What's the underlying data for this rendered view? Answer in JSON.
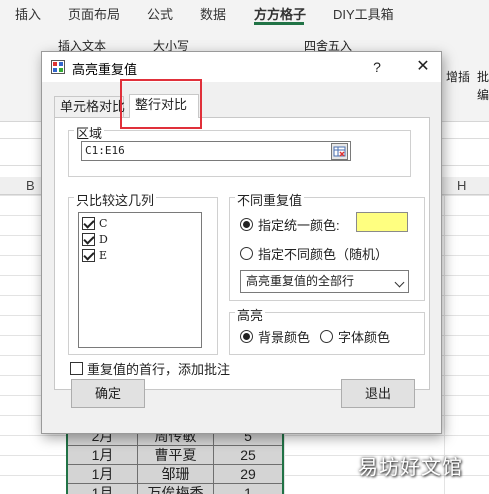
{
  "excel": {
    "tabs": [
      "插入",
      "页面布局",
      "公式",
      "数据",
      "方方格子",
      "DIY工具箱"
    ],
    "active_tab": "方方格子",
    "ribbon": {
      "insert_text": "插入文本",
      "case": "大小写",
      "round": "四舍五入",
      "insert": "增插",
      "batch": "批",
      "edit": "编"
    },
    "column_headers": [
      "B",
      "H"
    ],
    "rows": [
      [
        "2月",
        "周传敏",
        "5"
      ],
      [
        "1月",
        "曹平夏",
        "25"
      ],
      [
        "1月",
        "邹珊",
        "29"
      ],
      [
        "1月",
        "万俟梅香",
        "1"
      ]
    ]
  },
  "dialog": {
    "title": "高亮重复值",
    "help": "?",
    "close": "✕",
    "tabs": [
      "单元格对比",
      "整行对比"
    ],
    "selected_tab": "整行对比",
    "range_group": {
      "label": "区域",
      "value": "C1:E16"
    },
    "columns_group": {
      "label": "只比较这几列",
      "items": [
        {
          "label": "C",
          "checked": true
        },
        {
          "label": "D",
          "checked": true
        },
        {
          "label": "E",
          "checked": true
        }
      ]
    },
    "nondup_group": {
      "label": "不同重复值",
      "option_uniform": "指定统一颜色:",
      "option_different": "指定不同颜色（随机）",
      "uniform_selected": true,
      "swatch_color": "#ffff80",
      "dropdown_value": "高亮重复值的全部行"
    },
    "highlight_group": {
      "label": "高亮",
      "option_bg": "背景颜色",
      "option_font": "字体颜色",
      "bg_selected": true
    },
    "first_row_comment": "重复值的首行，添加批注",
    "first_row_comment_checked": false,
    "ok_label": "确定",
    "exit_label": "退出"
  },
  "watermark": "易坊好文馆",
  "colors": {
    "accent_green": "#217346",
    "highlight_red": "#e0303a"
  }
}
